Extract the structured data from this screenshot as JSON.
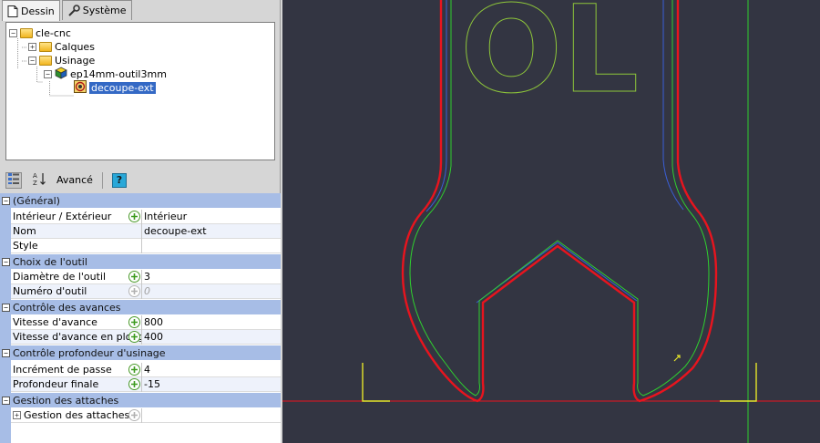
{
  "tabs": [
    {
      "label": "Dessin",
      "icon": "document-icon"
    },
    {
      "label": "Système",
      "icon": "wrench-icon"
    }
  ],
  "tree": {
    "root": "cle-cnc",
    "calques": "Calques",
    "usinage": "Usinage",
    "tool": "ep14mm-outil3mm",
    "operation": "decoupe-ext"
  },
  "toolbar": {
    "advanced_label": "Avancé",
    "help_label": "?"
  },
  "properties": {
    "general": {
      "title": "(Général)",
      "interior_exterior_name": "Intérieur / Extérieur",
      "interior_exterior_value": "Intérieur",
      "nom_name": "Nom",
      "nom_value": "decoupe-ext",
      "style_name": "Style",
      "style_value": ""
    },
    "tool": {
      "title": "Choix de l'outil",
      "diameter_name": "Diamètre de l'outil",
      "diameter_value": "3",
      "number_name": "Numéro d'outil",
      "number_value": "0"
    },
    "feeds": {
      "title": "Contrôle des avances",
      "feed_name": "Vitesse d'avance",
      "feed_value": "800",
      "plunge_name": "Vitesse d'avance en plongée",
      "plunge_value": "400"
    },
    "depth": {
      "title": "Contrôle profondeur d'usinage",
      "increment_name": "Incrément de passe",
      "increment_value": "4",
      "final_name": "Profondeur finale",
      "final_value": "-15"
    },
    "attach": {
      "title": "Gestion des attaches",
      "item_name": "Gestion des attaches",
      "item_value": ""
    }
  },
  "colors": {
    "canvas_bg": "#333542",
    "part_outline": "#e8141e",
    "toolpath": "#2fd02f",
    "inner_path": "#3a5fd8",
    "axis_yellow": "#e5e52a",
    "section_bg": "#a7bde6",
    "selection": "#3469c5"
  },
  "canvas_text": "OL"
}
